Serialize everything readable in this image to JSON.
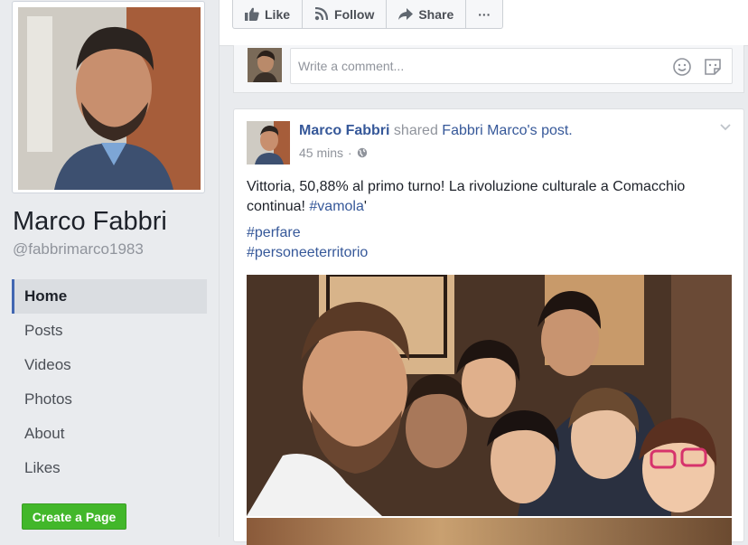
{
  "profile": {
    "name": "Marco Fabbri",
    "handle": "@fabbrimarco1983"
  },
  "nav": {
    "items": [
      {
        "label": "Home",
        "active": true
      },
      {
        "label": "Posts"
      },
      {
        "label": "Videos"
      },
      {
        "label": "Photos"
      },
      {
        "label": "About"
      },
      {
        "label": "Likes"
      }
    ],
    "create_page": "Create a Page"
  },
  "actions": {
    "like": "Like",
    "follow": "Follow",
    "share": "Share",
    "more": "···"
  },
  "comment": {
    "placeholder": "Write a comment..."
  },
  "post": {
    "author": "Marco Fabbri",
    "shared_text": "shared",
    "original_author": "Fabbri Marco",
    "possessive": "'s",
    "post_word": "post.",
    "time": "45 mins",
    "separator": "·",
    "text_main": "Vittoria, 50,88% al primo turno! La rivoluzione culturale a Comacchio continua! ",
    "text_tag": "#vamola",
    "text_end": "'",
    "hashtags": [
      "#perfare",
      "#personeeterritorio"
    ]
  },
  "colors": {
    "link": "#365899",
    "accent": "#4267b2",
    "create_button": "#42b72a",
    "background": "#e9ebee"
  }
}
